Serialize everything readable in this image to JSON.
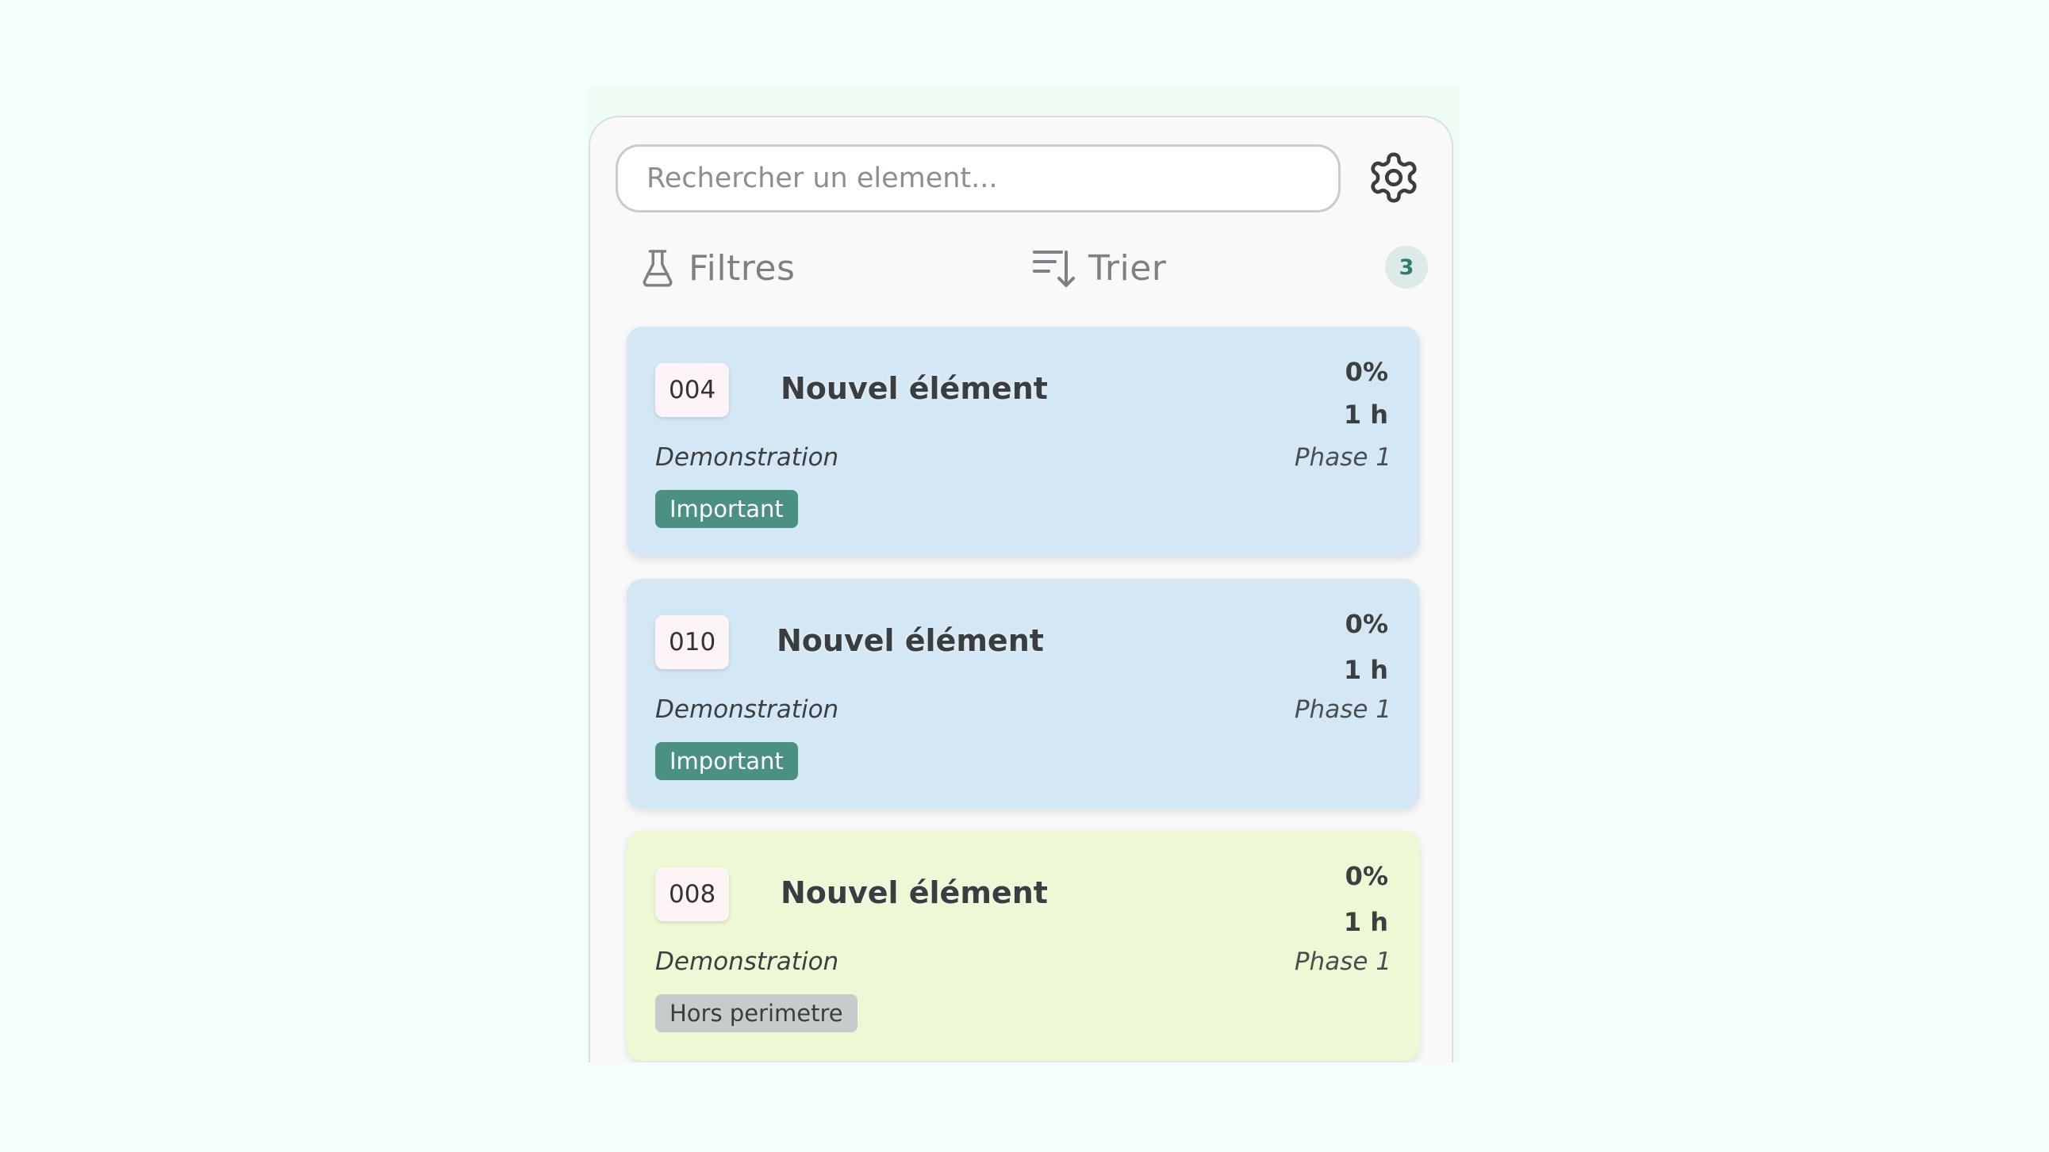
{
  "search": {
    "placeholder": "Rechercher un element..."
  },
  "icons": {
    "settings": "gear-icon",
    "filter": "flask-icon",
    "sort": "sort-descending-icon"
  },
  "toolbar": {
    "filter_label": "Filtres",
    "sort_label": "Trier",
    "count": "3"
  },
  "colors": {
    "background": "#f3fffa",
    "card_blue": "#d3e7f5",
    "card_green": "#edf8d5",
    "tag_important": "#4a9183",
    "tag_hors": "#c8cbcb",
    "badge_count_text": "#2e7b70"
  },
  "cards": [
    {
      "id": "004",
      "title": "Nouvel élément",
      "percent": "0%",
      "hours": "1 h",
      "project": "Demonstration",
      "phase": "Phase 1",
      "tag": "Important",
      "color": "#d3e7f5"
    },
    {
      "id": "010",
      "title": "Nouvel élément",
      "percent": "0%",
      "hours": "1 h",
      "project": "Demonstration",
      "phase": "Phase 1",
      "tag": "Important",
      "color": "#d3e7f5"
    },
    {
      "id": "008",
      "title": "Nouvel élément",
      "percent": "0%",
      "hours": "1 h",
      "project": "Demonstration",
      "phase": "Phase 1",
      "tag": "Hors perimetre",
      "color": "#edf8d5"
    }
  ]
}
